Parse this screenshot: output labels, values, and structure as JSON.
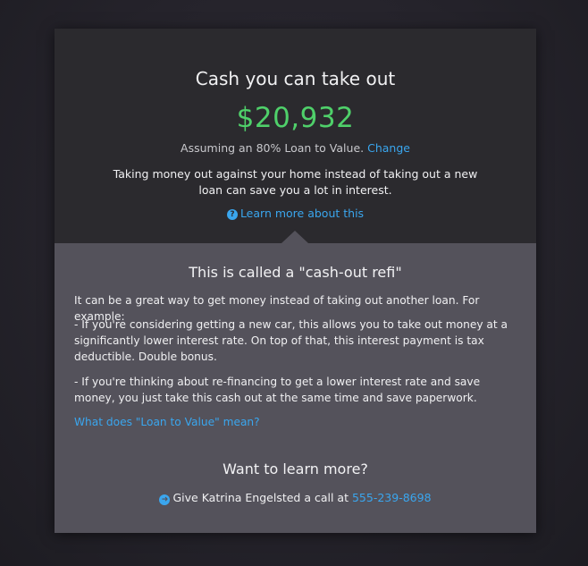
{
  "hero": {
    "title": "Cash you can take out",
    "amount": "$20,932",
    "assumption": "Assuming an 80% Loan to Value.",
    "change_link": "Change",
    "description": "Taking money out against your home instead of taking out a new loan can save you a lot in interest.",
    "learn_more_link": "Learn more about this"
  },
  "details": {
    "title": "This is called a \"cash-out refi\"",
    "intro": "It can be a great way to get money instead of taking out another loan. For example:",
    "point_car": "- If you're considering getting a new car, this allows you to take out money at a significantly lower interest rate. On top of that, this interest payment is tax deductible. Double bonus.",
    "point_refinance": "- If you're thinking about re-financing to get a lower interest rate and save money, you just take this cash out at the same time and save paperwork.",
    "ltv_link": "What does \"Loan to Value\" mean?",
    "more_title": "Want to learn more?",
    "call_text": "Give Katrina Engelsted a call at",
    "phone": "555-239-8698"
  },
  "icons": {
    "question": "question-circle-icon",
    "arrow": "arrow-circle-right-icon"
  },
  "colors": {
    "amount_green": "#4fd06a",
    "link_blue": "#3aa6ee",
    "top_panel": "#2b2a2e",
    "bottom_panel": "#54525b"
  }
}
